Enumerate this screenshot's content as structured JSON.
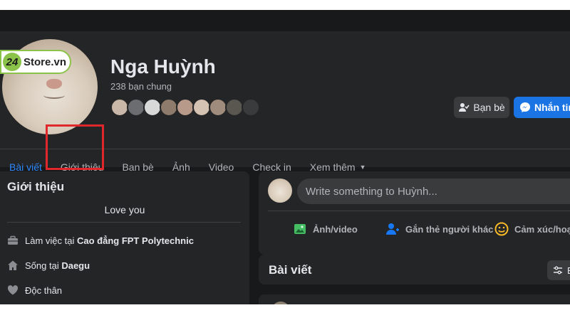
{
  "watermark": {
    "badge": "24",
    "text": "Store.vn"
  },
  "profile": {
    "name": "Nga Huỳnh",
    "mutual_friends": "238 bạn chung",
    "friend_avatar_colors": [
      "#c9b8a8",
      "#6b6d70",
      "#d8d8d8",
      "#8e7b6c",
      "#b89a8a",
      "#d4c2b2",
      "#a08c7c",
      "#5a5650",
      "#3a3b3c"
    ]
  },
  "actions": {
    "friends": "Bạn bè",
    "message": "Nhắn tin"
  },
  "tabs": [
    {
      "label": "Bài viết",
      "active": true
    },
    {
      "label": "Giới thiệu",
      "active": false
    },
    {
      "label": "Bạn bè",
      "active": false
    },
    {
      "label": "Ảnh",
      "active": false
    },
    {
      "label": "Video",
      "active": false
    },
    {
      "label": "Check in",
      "active": false
    },
    {
      "label": "Xem thêm",
      "active": false
    }
  ],
  "intro": {
    "title": "Giới thiệu",
    "bio": "Love you",
    "work_prefix": "Làm việc tại ",
    "work_place": "Cao đẳng FPT Polytechnic",
    "lives_prefix": "Sống tại ",
    "lives_place": "Daegu",
    "relationship": "Độc thân"
  },
  "composer": {
    "placeholder": "Write something to Huỳnh...",
    "photo_video": "Ảnh/video",
    "tag_people": "Gắn thẻ người khác",
    "feeling": "Cảm xúc/hoạt"
  },
  "posts": {
    "title": "Bài viết",
    "filter": "B"
  },
  "colors": {
    "accent": "#2d88ff",
    "highlight": "#e0272c",
    "brand_green": "#8bc34a"
  }
}
